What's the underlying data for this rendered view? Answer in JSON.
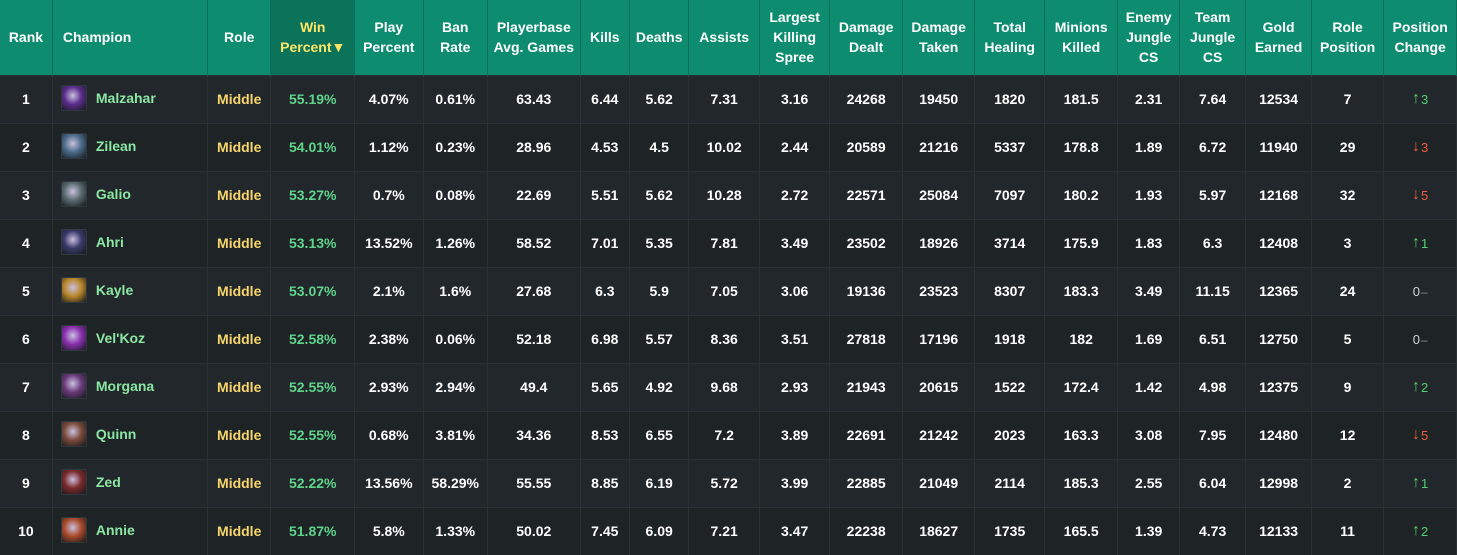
{
  "headers": {
    "rank": "Rank",
    "champion": "Champion",
    "role": "Role",
    "win_percent": "Win Percent▼",
    "play_percent": "Play Percent",
    "ban_rate": "Ban Rate",
    "playerbase_avg_games": "Playerbase Avg. Games",
    "kills": "Kills",
    "deaths": "Deaths",
    "assists": "Assists",
    "largest_killing_spree": "Largest Killing Spree",
    "damage_dealt": "Damage Dealt",
    "damage_taken": "Damage Taken",
    "total_healing": "Total Healing",
    "minions_killed": "Minions Killed",
    "enemy_jungle_cs": "Enemy Jungle CS",
    "team_jungle_cs": "Team Jungle CS",
    "gold_earned": "Gold Earned",
    "role_position": "Role Position",
    "position_change": "Position Change"
  },
  "colors": {
    "header_bg": "#0e8c6f",
    "sorted_header_text": "#ffe566",
    "role_text": "#f7d56c",
    "win_text": "#5fd48b",
    "champion_text": "#8ce6a3",
    "up": "#52d16f",
    "down": "#ef5a3a"
  },
  "rows": [
    {
      "rank": "1",
      "champion": "Malzahar",
      "icon_color": "#5b2c8c",
      "role": "Middle",
      "win": "55.19%",
      "play": "4.07%",
      "ban": "0.61%",
      "avg_games": "63.43",
      "kills": "6.44",
      "deaths": "5.62",
      "assists": "7.31",
      "spree": "3.16",
      "dmg_dealt": "24268",
      "dmg_taken": "19450",
      "healing": "1820",
      "minions": "181.5",
      "enemy_jungle": "2.31",
      "team_jungle": "7.64",
      "gold": "12534",
      "role_pos": "7",
      "change": "3",
      "change_dir": "up"
    },
    {
      "rank": "2",
      "champion": "Zilean",
      "icon_color": "#4a6b8a",
      "role": "Middle",
      "win": "54.01%",
      "play": "1.12%",
      "ban": "0.23%",
      "avg_games": "28.96",
      "kills": "4.53",
      "deaths": "4.5",
      "assists": "10.02",
      "spree": "2.44",
      "dmg_dealt": "20589",
      "dmg_taken": "21216",
      "healing": "5337",
      "minions": "178.8",
      "enemy_jungle": "1.89",
      "team_jungle": "6.72",
      "gold": "11940",
      "role_pos": "29",
      "change": "3",
      "change_dir": "down"
    },
    {
      "rank": "3",
      "champion": "Galio",
      "icon_color": "#5a6a70",
      "role": "Middle",
      "win": "53.27%",
      "play": "0.7%",
      "ban": "0.08%",
      "avg_games": "22.69",
      "kills": "5.51",
      "deaths": "5.62",
      "assists": "10.28",
      "spree": "2.72",
      "dmg_dealt": "22571",
      "dmg_taken": "25084",
      "healing": "7097",
      "minions": "180.2",
      "enemy_jungle": "1.93",
      "team_jungle": "5.97",
      "gold": "12168",
      "role_pos": "32",
      "change": "5",
      "change_dir": "down"
    },
    {
      "rank": "4",
      "champion": "Ahri",
      "icon_color": "#3a3a6a",
      "role": "Middle",
      "win": "53.13%",
      "play": "13.52%",
      "ban": "1.26%",
      "avg_games": "58.52",
      "kills": "7.01",
      "deaths": "5.35",
      "assists": "7.81",
      "spree": "3.49",
      "dmg_dealt": "23502",
      "dmg_taken": "18926",
      "healing": "3714",
      "minions": "175.9",
      "enemy_jungle": "1.83",
      "team_jungle": "6.3",
      "gold": "12408",
      "role_pos": "3",
      "change": "1",
      "change_dir": "up"
    },
    {
      "rank": "5",
      "champion": "Kayle",
      "icon_color": "#b8862a",
      "role": "Middle",
      "win": "53.07%",
      "play": "2.1%",
      "ban": "1.6%",
      "avg_games": "27.68",
      "kills": "6.3",
      "deaths": "5.9",
      "assists": "7.05",
      "spree": "3.06",
      "dmg_dealt": "19136",
      "dmg_taken": "23523",
      "healing": "8307",
      "minions": "183.3",
      "enemy_jungle": "3.49",
      "team_jungle": "11.15",
      "gold": "12365",
      "role_pos": "24",
      "change": "0",
      "change_dir": "zero"
    },
    {
      "rank": "6",
      "champion": "Vel'Koz",
      "icon_color": "#8a2fae",
      "role": "Middle",
      "win": "52.58%",
      "play": "2.38%",
      "ban": "0.06%",
      "avg_games": "52.18",
      "kills": "6.98",
      "deaths": "5.57",
      "assists": "8.36",
      "spree": "3.51",
      "dmg_dealt": "27818",
      "dmg_taken": "17196",
      "healing": "1918",
      "minions": "182",
      "enemy_jungle": "1.69",
      "team_jungle": "6.51",
      "gold": "12750",
      "role_pos": "5",
      "change": "0",
      "change_dir": "zero"
    },
    {
      "rank": "7",
      "champion": "Morgana",
      "icon_color": "#6a3a7a",
      "role": "Middle",
      "win": "52.55%",
      "play": "2.93%",
      "ban": "2.94%",
      "avg_games": "49.4",
      "kills": "5.65",
      "deaths": "4.92",
      "assists": "9.68",
      "spree": "2.93",
      "dmg_dealt": "21943",
      "dmg_taken": "20615",
      "healing": "1522",
      "minions": "172.4",
      "enemy_jungle": "1.42",
      "team_jungle": "4.98",
      "gold": "12375",
      "role_pos": "9",
      "change": "2",
      "change_dir": "up"
    },
    {
      "rank": "8",
      "champion": "Quinn",
      "icon_color": "#7a4a3a",
      "role": "Middle",
      "win": "52.55%",
      "play": "0.68%",
      "ban": "3.81%",
      "avg_games": "34.36",
      "kills": "8.53",
      "deaths": "6.55",
      "assists": "7.2",
      "spree": "3.89",
      "dmg_dealt": "22691",
      "dmg_taken": "21242",
      "healing": "2023",
      "minions": "163.3",
      "enemy_jungle": "3.08",
      "team_jungle": "7.95",
      "gold": "12480",
      "role_pos": "12",
      "change": "5",
      "change_dir": "down"
    },
    {
      "rank": "9",
      "champion": "Zed",
      "icon_color": "#7a2a2a",
      "role": "Middle",
      "win": "52.22%",
      "play": "13.56%",
      "ban": "58.29%",
      "avg_games": "55.55",
      "kills": "8.85",
      "deaths": "6.19",
      "assists": "5.72",
      "spree": "3.99",
      "dmg_dealt": "22885",
      "dmg_taken": "21049",
      "healing": "2114",
      "minions": "185.3",
      "enemy_jungle": "2.55",
      "team_jungle": "6.04",
      "gold": "12998",
      "role_pos": "2",
      "change": "1",
      "change_dir": "up"
    },
    {
      "rank": "10",
      "champion": "Annie",
      "icon_color": "#a84a2a",
      "role": "Middle",
      "win": "51.87%",
      "play": "5.8%",
      "ban": "1.33%",
      "avg_games": "50.02",
      "kills": "7.45",
      "deaths": "6.09",
      "assists": "7.21",
      "spree": "3.47",
      "dmg_dealt": "22238",
      "dmg_taken": "18627",
      "healing": "1735",
      "minions": "165.5",
      "enemy_jungle": "1.39",
      "team_jungle": "4.73",
      "gold": "12133",
      "role_pos": "11",
      "change": "2",
      "change_dir": "up"
    }
  ]
}
